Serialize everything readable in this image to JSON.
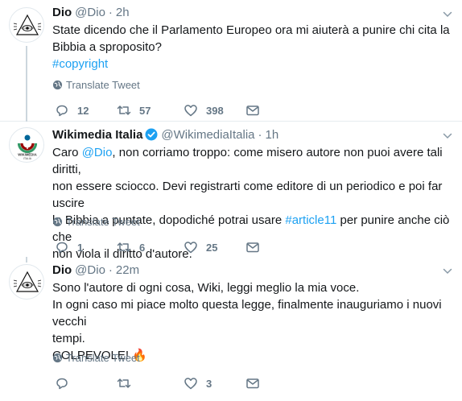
{
  "tweets": [
    {
      "name": "Dio",
      "handle": "@Dio",
      "dot": "·",
      "time": "2h",
      "verified": false,
      "lines": [
        "State dicendo che il Parlamento Europeo ora mi aiuterà a punire chi cita la",
        "Bibbia a sproposito?"
      ],
      "hashtag": "#copyright",
      "translate": "Translate Tweet",
      "replies": "12",
      "retweets": "57",
      "likes": "398"
    },
    {
      "name": "Wikimedia Italia",
      "handle": "@WikimediaItalia",
      "dot": "·",
      "time": "1h",
      "verified": true,
      "avatar_caption": "WIKIMEDIA",
      "avatar_subcaption": "ITALIA",
      "line1_pre": "Caro ",
      "mention": "@Dio",
      "line1_post": ", non corriamo troppo: come misero autore non puoi avere tali diritti,",
      "line2": "non essere sciocco. Devi registrarti come editore di un periodico e poi far uscire",
      "line3_pre": "la Bibbia a puntate, dopodiché potrai usare ",
      "hashtag": "#article11",
      "line3_post": " per punire anche ciò che",
      "line4": "non viola il diritto d'autore.",
      "translate": "Translate Tweet",
      "replies": "1",
      "retweets": "6",
      "likes": "25"
    },
    {
      "name": "Dio",
      "handle": "@Dio",
      "dot": "·",
      "time": "22m",
      "verified": false,
      "line1": "Sono l'autore di ogni cosa, Wiki, leggi meglio la mia voce.",
      "line2": "In ogni caso mi piace molto questa legge, finalmente inauguriamo i nuovi vecchi",
      "line3": "tempi.",
      "line4": "COLPEVOLE! 🔥",
      "translate": "Translate Tweet",
      "replies": "",
      "retweets": "",
      "likes": "3"
    }
  ],
  "colors": {
    "link": "#1da1f2",
    "secondary": "#657786",
    "text": "#14171a",
    "divider": "#e6ecf0"
  }
}
